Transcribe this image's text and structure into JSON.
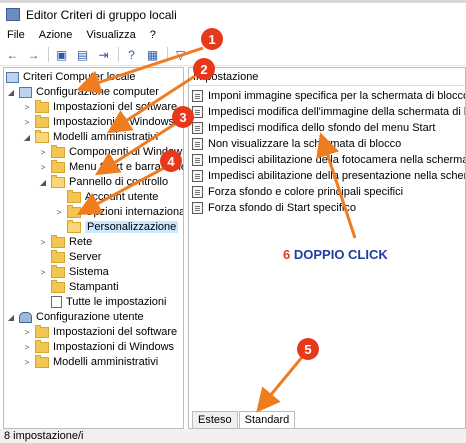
{
  "window": {
    "title": "Editor Criteri di gruppo locali"
  },
  "menu": [
    "File",
    "Azione",
    "Visualizza",
    "?"
  ],
  "tree": [
    {
      "label": "Criteri Computer locale",
      "icon": "computer-icon"
    },
    {
      "label": "Configurazione computer",
      "icon": "computer-icon",
      "expanded": true
    },
    {
      "label": "Impostazioni del software",
      "icon": "folder-icon"
    },
    {
      "label": "Impostazioni di Windows",
      "icon": "folder-icon"
    },
    {
      "label": "Modelli amministrativi",
      "icon": "folder-icon",
      "expanded": true
    },
    {
      "label": "Componenti di Windows",
      "icon": "folder-icon"
    },
    {
      "label": "Menu Start e barra delle",
      "icon": "folder-icon"
    },
    {
      "label": "Pannello di controllo",
      "icon": "folder-icon",
      "expanded": true
    },
    {
      "label": "Account utente",
      "icon": "folder-icon"
    },
    {
      "label": "Opzioni internazionali e d",
      "icon": "folder-icon"
    },
    {
      "label": "Personalizzazione",
      "icon": "folder-icon",
      "selected": true
    },
    {
      "label": "Rete",
      "icon": "folder-icon"
    },
    {
      "label": "Server",
      "icon": "folder-icon"
    },
    {
      "label": "Sistema",
      "icon": "folder-icon"
    },
    {
      "label": "Stampanti",
      "icon": "folder-icon"
    },
    {
      "label": "Tutte le impostazioni",
      "icon": "document-icon"
    },
    {
      "label": "Configurazione utente",
      "icon": "users-icon",
      "expanded": true
    },
    {
      "label": "Impostazioni del software",
      "icon": "folder-icon"
    },
    {
      "label": "Impostazioni di Windows",
      "icon": "folder-icon"
    },
    {
      "label": "Modelli amministrativi",
      "icon": "folder-icon"
    }
  ],
  "list": {
    "header": "Impostazione",
    "items": [
      "Imponi immagine specifica per la schermata di blocco pred",
      "Impedisci modifica dell'immagine della schermata di blocco.",
      "Impedisci modifica dello sfondo del menu Start",
      "Non visualizzare la schermata di blocco",
      "Impedisci abilitazione della fotocamera nella schermata di b",
      "Impedisci abilitazione della presentazione nella schermata di",
      "Forza sfondo e colore principali specifici",
      "Forza sfondo di Start specifico"
    ]
  },
  "tabs": [
    "Esteso",
    "Standard"
  ],
  "status": "8 impostazione/i",
  "annotations": {
    "badges": [
      "1",
      "2",
      "3",
      "4",
      "5"
    ],
    "step_number": "6",
    "step_text": "DOPPIO CLICK"
  },
  "colors": {
    "annotation_orange": "#f07c20",
    "badge_red": "#e8381c",
    "text_blue": "#1f3fa0",
    "selection": "#cce8ff"
  }
}
